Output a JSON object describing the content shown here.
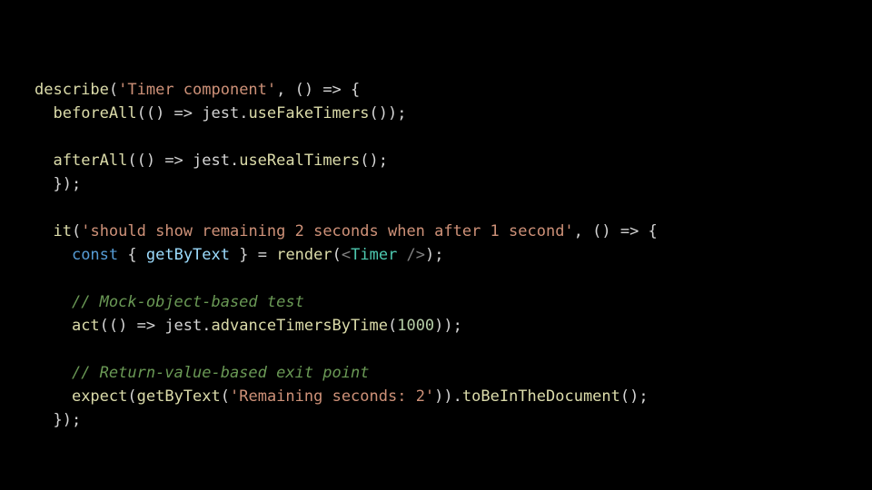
{
  "code": {
    "l1": {
      "fn_describe": "describe",
      "str": "'Timer component'",
      "rest1": "(",
      "rest2": ", () => {"
    },
    "l2": {
      "indent": "  ",
      "fn_before": "beforeAll",
      "mid": "(() => jest.",
      "fn_use": "useFakeTimers",
      "tail": "());"
    },
    "l3": "",
    "l4": {
      "indent": "  ",
      "fn_after": "afterAll",
      "mid": "(() => jest.",
      "fn_use": "useRealTimers",
      "tail": "();"
    },
    "l5": {
      "indent": "  ",
      "text": "});"
    },
    "l6": "",
    "l7": {
      "indent": "  ",
      "fn_it": "it",
      "open": "(",
      "str": "'should show remaining 2 seconds when after 1 second'",
      "rest": ", () => {"
    },
    "l8": {
      "indent": "    ",
      "kw": "const",
      "sp": " ",
      "destruct_open": "{ ",
      "var": "getByText",
      "destruct_close": " }",
      "eq": " = ",
      "fn_render": "render",
      "paren_open": "(",
      "jsx_open": "<",
      "type": "Timer",
      "jsx_close": " />",
      "paren_close": ");"
    },
    "l9": "",
    "l10": {
      "indent": "    ",
      "comment": "// Mock-object-based test"
    },
    "l11": {
      "indent": "    ",
      "fn_act": "act",
      "mid": "(() => jest.",
      "fn_adv": "advanceTimersByTime",
      "open": "(",
      "num": "1000",
      "close": "));"
    },
    "l12": "",
    "l13": {
      "indent": "    ",
      "comment": "// Return-value-based exit point"
    },
    "l14": {
      "indent": "    ",
      "fn_expect": "expect",
      "open1": "(",
      "fn_get": "getByText",
      "open2": "(",
      "str": "'Remaining seconds: 2'",
      "close2": ")).",
      "fn_tobe": "toBeInTheDocument",
      "close3": "();"
    },
    "l15": {
      "indent": "  ",
      "text": "});"
    }
  }
}
